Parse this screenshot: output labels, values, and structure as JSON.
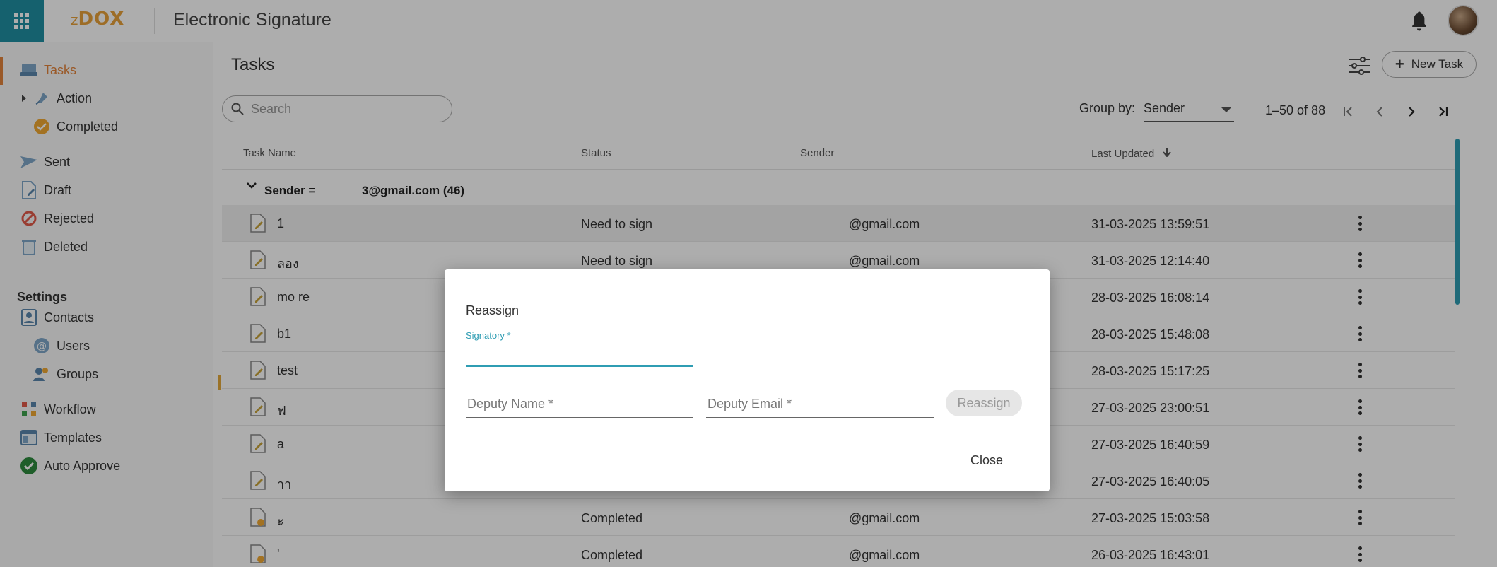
{
  "app": {
    "logo_prefix": "z",
    "logo_main": "DOX",
    "title": "Electronic Signature"
  },
  "sidebar": {
    "items": [
      {
        "label": "Tasks",
        "icon": "inbox-tray-icon"
      },
      {
        "label": "Action",
        "icon": "pen-action-icon"
      },
      {
        "label": "Completed",
        "icon": "completed-badge-icon"
      },
      {
        "label": "Sent",
        "icon": "paper-plane-icon"
      },
      {
        "label": "Draft",
        "icon": "draft-doc-icon"
      },
      {
        "label": "Rejected",
        "icon": "rejected-circle-icon"
      },
      {
        "label": "Deleted",
        "icon": "trash-icon"
      }
    ],
    "settings_heading": "Settings",
    "settings_items": [
      {
        "label": "Contacts",
        "icon": "contacts-icon"
      },
      {
        "label": "Users",
        "icon": "user-at-icon"
      },
      {
        "label": "Groups",
        "icon": "group-icon"
      },
      {
        "label": "Workflow",
        "icon": "workflow-icon"
      },
      {
        "label": "Templates",
        "icon": "templates-icon"
      },
      {
        "label": "Auto Approve",
        "icon": "check-badge-icon"
      }
    ]
  },
  "main": {
    "page_title": "Tasks",
    "new_task_label": "New Task",
    "search_placeholder": "Search",
    "group_by_label": "Group by:",
    "group_by_value": "Sender",
    "page_range": "1–50 of 88",
    "columns": {
      "task_name": "Task Name",
      "status": "Status",
      "sender": "Sender",
      "last_updated": "Last Updated"
    },
    "group": {
      "prefix": "Sender = ",
      "suffix": "3@gmail.com (46)"
    },
    "rows": [
      {
        "name": "1",
        "status": "Need to sign",
        "sender": "@gmail.com",
        "updated": "31-03-2025 13:59:51"
      },
      {
        "name": "ลอง",
        "status": "Need to sign",
        "sender": "@gmail.com",
        "updated": "31-03-2025 12:14:40"
      },
      {
        "name": "mo re",
        "status": "",
        "sender": "",
        "updated": "28-03-2025 16:08:14"
      },
      {
        "name": "b1",
        "status": "",
        "sender": "",
        "updated": "28-03-2025 15:48:08"
      },
      {
        "name": "test",
        "status": "",
        "sender": "",
        "updated": "28-03-2025 15:17:25"
      },
      {
        "name": "ฟ",
        "status": "",
        "sender": "",
        "updated": "27-03-2025 23:00:51"
      },
      {
        "name": "a",
        "status": "",
        "sender": "",
        "updated": "27-03-2025 16:40:59"
      },
      {
        "name": "าา",
        "status": "",
        "sender": "",
        "updated": "27-03-2025 16:40:05"
      },
      {
        "name": "ะ",
        "status": "Completed",
        "sender": "@gmail.com",
        "updated": "27-03-2025 15:03:58"
      },
      {
        "name": "'",
        "status": "Completed",
        "sender": "@gmail.com",
        "updated": "26-03-2025 16:43:01"
      }
    ]
  },
  "modal": {
    "title": "Reassign",
    "signatory_label": "Signatory *",
    "signatory_value": "",
    "deputy_name_placeholder": "Deputy Name *",
    "deputy_email_placeholder": "Deputy Email *",
    "reassign_label": "Reassign",
    "close_label": "Close"
  },
  "colors": {
    "accent": "#2f9db3",
    "active": "#e3843c",
    "logo": "#e8a13a"
  }
}
